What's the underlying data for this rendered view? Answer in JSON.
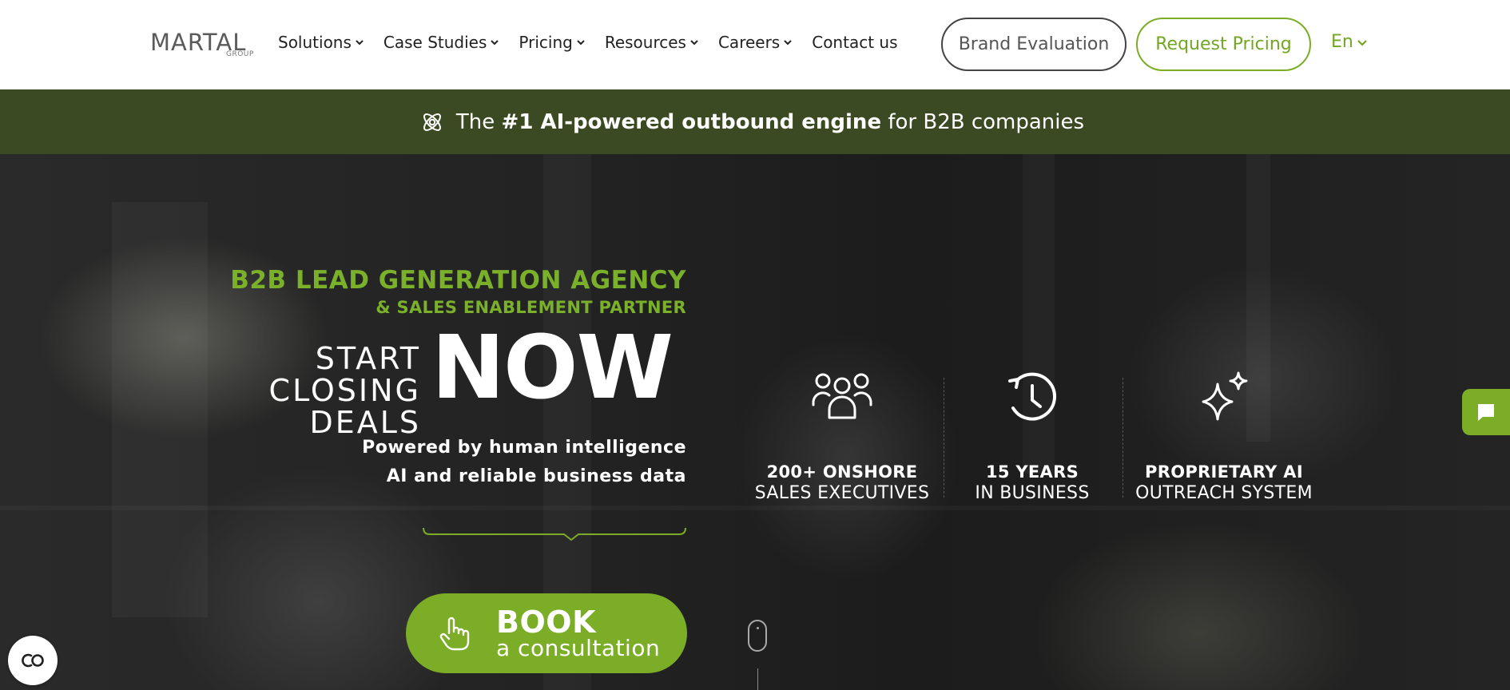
{
  "header": {
    "logo_text": "MARTAL",
    "logo_sub": "GROUP",
    "nav": [
      {
        "label": "Solutions",
        "has_dropdown": true
      },
      {
        "label": "Case Studies",
        "has_dropdown": true
      },
      {
        "label": "Pricing",
        "has_dropdown": true
      },
      {
        "label": "Resources",
        "has_dropdown": true
      },
      {
        "label": "Careers",
        "has_dropdown": true
      },
      {
        "label": "Contact us",
        "has_dropdown": false
      }
    ],
    "brand_evaluation_label": "Brand Evaluation",
    "request_pricing_label": "Request Pricing",
    "language": "En"
  },
  "banner": {
    "icon": "atom-icon",
    "prefix": "The ",
    "bold": "#1 AI-powered outbound engine",
    "suffix": " for B2B companies"
  },
  "hero": {
    "kicker_line1": "B2B LEAD GENERATION AGENCY",
    "kicker_line2": "& SALES ENABLEMENT PARTNER",
    "start_line1": "START CLOSING",
    "start_line2": "DEALS",
    "now": "NOW",
    "powered_line1": "Powered by human intelligence",
    "powered_line2": "AI and reliable business data",
    "book": {
      "icon": "pointer-hand-icon",
      "main": "BOOK",
      "sub": "a consultation"
    },
    "stats": [
      {
        "icon": "team-icon",
        "line1": "200+ ONSHORE",
        "line2": "SALES EXECUTIVES"
      },
      {
        "icon": "history-clock-icon",
        "line1": "15 YEARS",
        "line2": "IN BUSINESS"
      },
      {
        "icon": "sparkles-icon",
        "line1": "PROPRIETARY AI",
        "line2": "OUTREACH SYSTEM"
      }
    ]
  },
  "colors": {
    "accent_green": "#7bad27",
    "banner_bg": "#3b4a22",
    "hero_bg": "#222222"
  }
}
